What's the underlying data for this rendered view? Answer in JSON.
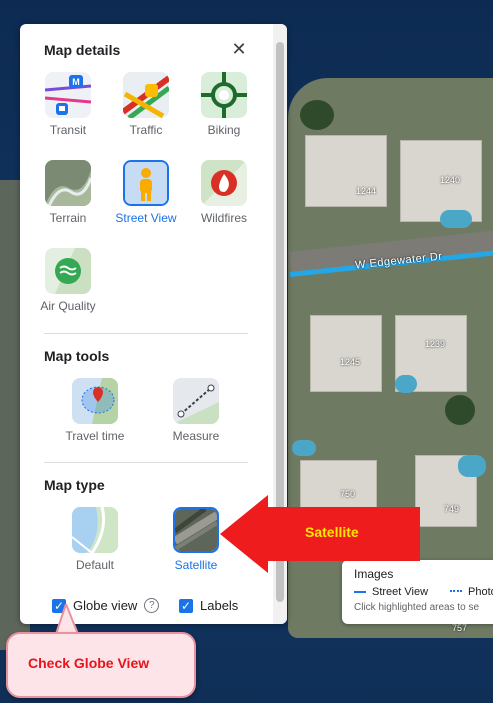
{
  "panel": {
    "map_details_title": "Map details",
    "close_icon": "close-icon",
    "details": [
      {
        "label": "Transit",
        "icon": "transit-icon"
      },
      {
        "label": "Traffic",
        "icon": "traffic-icon"
      },
      {
        "label": "Biking",
        "icon": "biking-icon"
      },
      {
        "label": "Terrain",
        "icon": "terrain-icon"
      },
      {
        "label": "Street View",
        "icon": "street-view-icon",
        "selected": true
      },
      {
        "label": "Wildfires",
        "icon": "wildfires-icon"
      },
      {
        "label": "Air Quality",
        "icon": "air-quality-icon"
      }
    ],
    "map_tools_title": "Map tools",
    "tools": [
      {
        "label": "Travel time",
        "icon": "travel-time-icon"
      },
      {
        "label": "Measure",
        "icon": "measure-icon"
      }
    ],
    "map_type_title": "Map type",
    "types": [
      {
        "label": "Default",
        "icon": "default-map-icon"
      },
      {
        "label": "Satellite",
        "icon": "satellite-map-icon",
        "selected": true
      }
    ],
    "globe_view_label": "Globe view",
    "globe_view_checked": true,
    "labels_label": "Labels",
    "labels_checked": true
  },
  "map": {
    "street_label": "W Edgewater Dr",
    "addresses": [
      "1244",
      "1240",
      "1245",
      "1239",
      "750",
      "749",
      "757"
    ]
  },
  "images_card": {
    "title": "Images",
    "street_view": "Street View",
    "photos": "Photo",
    "hint": "Click highlighted areas to se"
  },
  "annotations": {
    "satellite_callout": "Satellite",
    "globe_callout": "Check Globe View"
  },
  "colors": {
    "accent": "#1a73e8",
    "callout_arrow": "#ee1c1c",
    "callout_text_yellow": "#ffe600",
    "callout_text_red": "#e8131b"
  }
}
